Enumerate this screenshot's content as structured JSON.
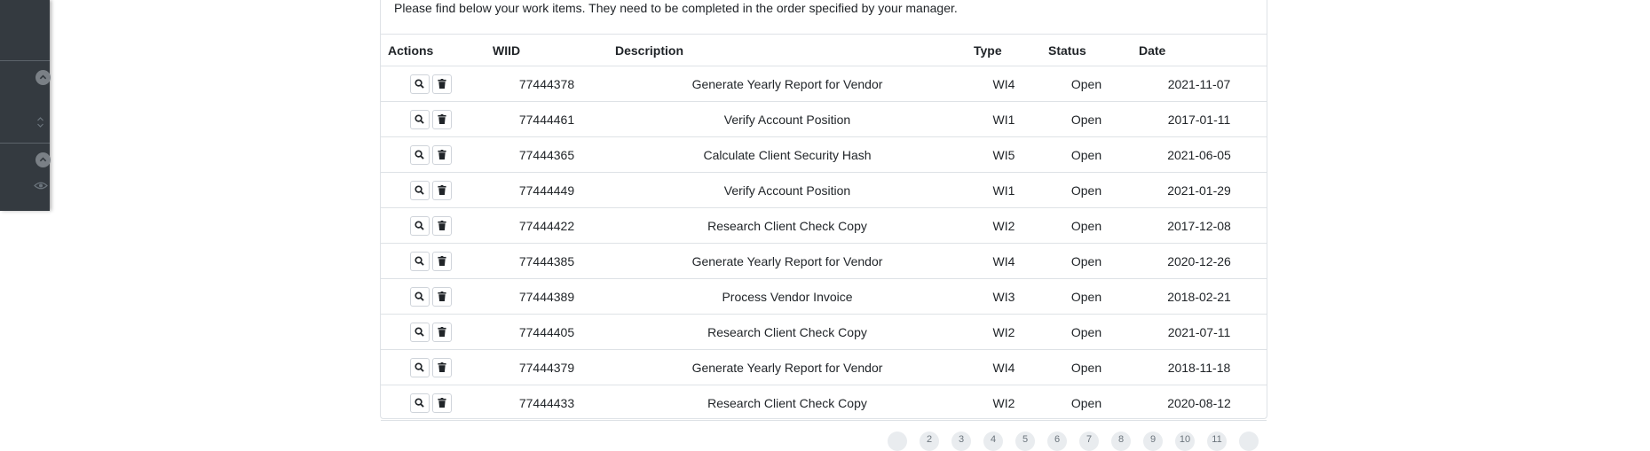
{
  "intro_text": "Please find below your work items. They need to be completed in the order specified by your manager.",
  "table": {
    "headers": [
      "Actions",
      "WIID",
      "Description",
      "Type",
      "Status",
      "Date"
    ],
    "rows": [
      {
        "wiid": "77444378",
        "description": "Generate Yearly Report for Vendor",
        "type": "WI4",
        "status": "Open",
        "date": "2021-11-07"
      },
      {
        "wiid": "77444461",
        "description": "Verify Account Position",
        "type": "WI1",
        "status": "Open",
        "date": "2017-01-11"
      },
      {
        "wiid": "77444365",
        "description": "Calculate Client Security Hash",
        "type": "WI5",
        "status": "Open",
        "date": "2021-06-05"
      },
      {
        "wiid": "77444449",
        "description": "Verify Account Position",
        "type": "WI1",
        "status": "Open",
        "date": "2021-01-29"
      },
      {
        "wiid": "77444422",
        "description": "Research Client Check Copy",
        "type": "WI2",
        "status": "Open",
        "date": "2017-12-08"
      },
      {
        "wiid": "77444385",
        "description": "Generate Yearly Report for Vendor",
        "type": "WI4",
        "status": "Open",
        "date": "2020-12-26"
      },
      {
        "wiid": "77444389",
        "description": "Process Vendor Invoice",
        "type": "WI3",
        "status": "Open",
        "date": "2018-02-21"
      },
      {
        "wiid": "77444405",
        "description": "Research Client Check Copy",
        "type": "WI2",
        "status": "Open",
        "date": "2021-07-11"
      },
      {
        "wiid": "77444379",
        "description": "Generate Yearly Report for Vendor",
        "type": "WI4",
        "status": "Open",
        "date": "2018-11-18"
      },
      {
        "wiid": "77444433",
        "description": "Research Client Check Copy",
        "type": "WI2",
        "status": "Open",
        "date": "2020-08-12"
      }
    ]
  },
  "pagination": [
    "",
    "2",
    "3",
    "4",
    "5",
    "6",
    "7",
    "8",
    "9",
    "10",
    "11",
    ""
  ],
  "icons": {
    "view": "search-icon",
    "delete": "trash-icon",
    "sidebar_collapse": "chevron-up-icon",
    "sidebar_sort": "sort-icon",
    "sidebar_eye": "eye-icon"
  },
  "colors": {
    "sidebar_bg": "#343a40",
    "border": "#dee2e6",
    "text": "#212529"
  }
}
